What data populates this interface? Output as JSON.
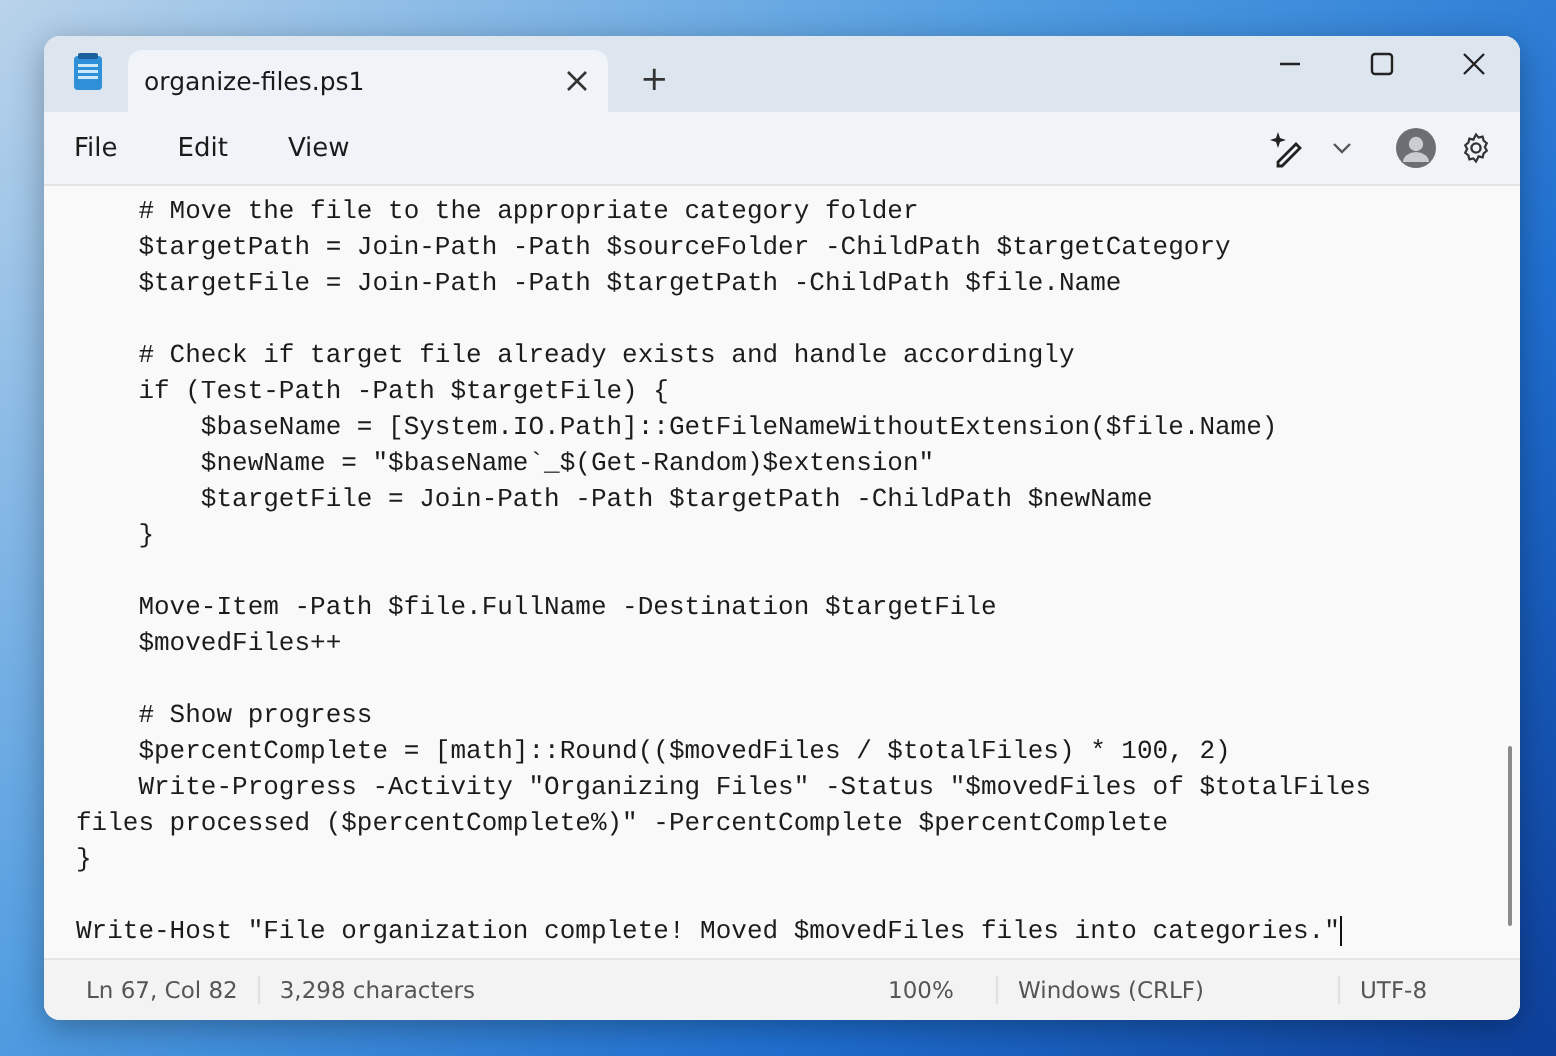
{
  "window": {
    "tabs": [
      {
        "label": "organize-files.ps1",
        "selected": true
      }
    ],
    "new_tab": "+"
  },
  "menu": [
    {
      "label": "File"
    },
    {
      "label": "Edit"
    },
    {
      "label": "View"
    }
  ],
  "editor": {
    "lines": [
      {
        "kind": "code",
        "text": "    # Move the file to the appropriate category folder"
      },
      {
        "kind": "code",
        "text": "    $targetPath = Join-Path -Path $sourceFolder -ChildPath $targetCategory"
      },
      {
        "kind": "code",
        "text": "    $targetFile = Join-Path -Path $targetPath -ChildPath $file.Name"
      },
      {
        "kind": "blank"
      },
      {
        "kind": "code",
        "text": "    # Check if target file already exists and handle accordingly"
      },
      {
        "kind": "code",
        "text": "    if (Test-Path -Path $targetFile) {"
      },
      {
        "kind": "code",
        "text": "        $baseName = [System.IO.Path]::GetFileNameWithoutExtension($file.Name)"
      },
      {
        "kind": "code",
        "text": "        $newName = \"$baseName`_$(Get-Random)$extension\""
      },
      {
        "kind": "code",
        "text": "        $targetFile = Join-Path -Path $targetPath -ChildPath $newName"
      },
      {
        "kind": "code",
        "text": "    }"
      },
      {
        "kind": "blank"
      },
      {
        "kind": "code",
        "text": "    Move-Item -Path $file.FullName -Destination $targetFile"
      },
      {
        "kind": "code",
        "text": "    $movedFiles++"
      },
      {
        "kind": "blank"
      },
      {
        "kind": "code",
        "text": "    # Show progress"
      },
      {
        "kind": "code",
        "text": "    $percentComplete = [math]::Round(($movedFiles / $totalFiles) * 100, 2)"
      },
      {
        "kind": "code",
        "text": "    Write-Progress -Activity \"Organizing Files\" -Status \"$movedFiles of $totalFiles"
      },
      {
        "kind": "code",
        "text": "files processed ($percentComplete%)\" -PercentComplete $percentComplete"
      },
      {
        "kind": "code",
        "text": "}"
      },
      {
        "kind": "blank"
      },
      {
        "kind": "cursor",
        "text": "Write-Host \"File organization complete! Moved $movedFiles files into categories.\""
      }
    ]
  },
  "status_bar": {
    "position": "Ln 67, Col 82",
    "characters": "3,298 characters",
    "zoom": "100%",
    "line_ending": "Windows (CRLF)",
    "encoding": "UTF-8"
  }
}
